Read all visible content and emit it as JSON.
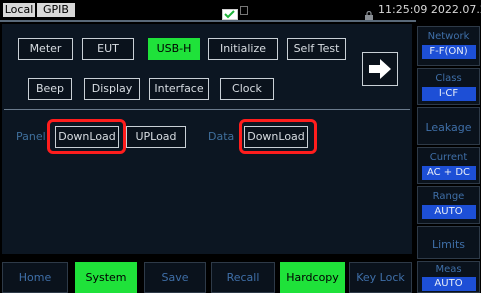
{
  "status": {
    "local": "Local",
    "gpib": "GPIB",
    "time": "11:25:09 2022.07.21"
  },
  "main": {
    "row1": [
      "Meter",
      "EUT",
      "USB-H",
      "Initialize",
      "Self Test"
    ],
    "row2": [
      "Beep",
      "Display",
      "Interface",
      "Clock"
    ],
    "panel_label": "Panel",
    "panel_download": "DownLoad",
    "panel_upload": "UPLoad",
    "data_label": "Data",
    "data_download": "DownLoad",
    "arrow_icon": "right-arrow-icon"
  },
  "right_keys": [
    {
      "title": "Network",
      "value": "F-F(ON)"
    },
    {
      "title": "Class",
      "value": "I-CF"
    },
    {
      "title": "Leakage"
    },
    {
      "title": "Current",
      "value": "AC + DC"
    },
    {
      "title": "Range",
      "value": "AUTO"
    },
    {
      "title": "Limits"
    },
    {
      "title": "Meas",
      "value": "AUTO"
    }
  ],
  "bottom_keys": [
    "Home",
    "System",
    "Save",
    "Recall",
    "Hardcopy",
    "Key Lock"
  ],
  "colors": {
    "active": "#1fe23a",
    "highlight": "#ff1d1d",
    "value_bg": "#1d4fd6",
    "label_blue": "#3f6fa8"
  }
}
